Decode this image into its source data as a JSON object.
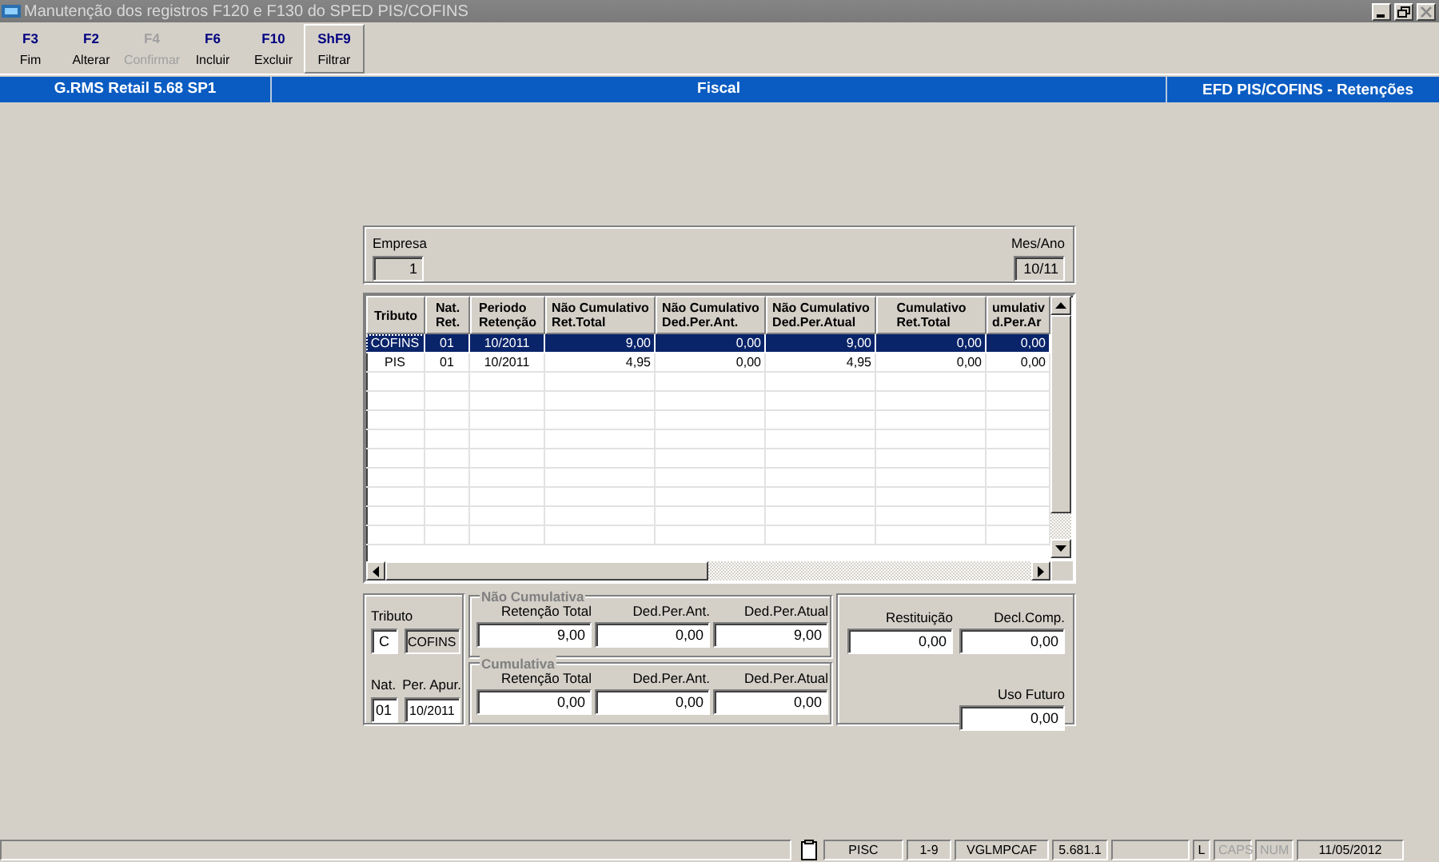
{
  "window": {
    "title": "Manutenção dos registros F120 e F130 do SPED PIS/COFINS"
  },
  "toolbar": [
    {
      "key": "F3",
      "label": "Fim",
      "disabled": false,
      "hover": false
    },
    {
      "key": "F2",
      "label": "Alterar",
      "disabled": false,
      "hover": false
    },
    {
      "key": "F4",
      "label": "Confirmar",
      "disabled": true,
      "hover": false
    },
    {
      "key": "F6",
      "label": "Incluir",
      "disabled": false,
      "hover": false
    },
    {
      "key": "F10",
      "label": "Excluir",
      "disabled": false,
      "hover": false
    },
    {
      "key": "ShF9",
      "label": "Filtrar",
      "disabled": false,
      "hover": true
    }
  ],
  "banner": {
    "left": "G.RMS Retail 5.68 SP1",
    "center": "Fiscal",
    "right": "EFD PIS/COFINS - Retenções"
  },
  "header": {
    "empresa": {
      "label": "Empresa",
      "value": "1"
    },
    "mes_ano": {
      "label": "Mes/Ano",
      "value": "10/11"
    }
  },
  "table": {
    "columns": [
      {
        "lines": [
          "Tributo"
        ]
      },
      {
        "lines": [
          "Nat.",
          "Ret."
        ]
      },
      {
        "lines": [
          "Periodo",
          "Retenção"
        ]
      },
      {
        "lines": [
          "Não Cumulativo",
          "Ret.Total"
        ]
      },
      {
        "lines": [
          "Não Cumulativo",
          "Ded.Per.Ant."
        ]
      },
      {
        "lines": [
          "Não Cumulativo",
          "Ded.Per.Atual"
        ]
      },
      {
        "lines": [
          "Cumulativo",
          "Ret.Total"
        ]
      },
      {
        "lines": [
          "umulativ",
          "d.Per.Ar"
        ]
      }
    ],
    "rows": [
      {
        "selected": true,
        "cells": [
          "COFINS",
          "01",
          "10/2011",
          "9,00",
          "0,00",
          "9,00",
          "0,00",
          "0,00"
        ]
      },
      {
        "selected": false,
        "cells": [
          "PIS",
          "01",
          "10/2011",
          "4,95",
          "0,00",
          "4,95",
          "0,00",
          "0,00"
        ]
      }
    ]
  },
  "detail": {
    "tributo": {
      "label": "Tributo",
      "code": "C",
      "name": "COFINS"
    },
    "nat": {
      "label": "Nat.",
      "value": "01"
    },
    "per_apur": {
      "label": "Per. Apur.",
      "value": "10/2011"
    },
    "groups": [
      {
        "title": "Não Cumulativa",
        "fields": [
          {
            "label": "Retenção Total",
            "value": "9,00"
          },
          {
            "label": "Ded.Per.Ant.",
            "value": "0,00"
          },
          {
            "label": "Ded.Per.Atual",
            "value": "9,00"
          }
        ]
      },
      {
        "title": "Cumulativa",
        "fields": [
          {
            "label": "Retenção Total",
            "value": "0,00"
          },
          {
            "label": "Ded.Per.Ant.",
            "value": "0,00"
          },
          {
            "label": "Ded.Per.Atual",
            "value": "0,00"
          }
        ]
      }
    ],
    "extra": [
      {
        "label": "Restituição",
        "value": "0,00"
      },
      {
        "label": "Decl.Comp.",
        "value": "0,00"
      },
      {
        "label": "Uso Futuro",
        "value": "0,00"
      }
    ]
  },
  "status_bar": [
    {
      "text": "PISC",
      "disabled": false
    },
    {
      "text": "1-9",
      "disabled": false
    },
    {
      "text": "VGLMPCAF",
      "disabled": false
    },
    {
      "text": "5.681.1",
      "disabled": false
    },
    {
      "text": "L",
      "disabled": false
    },
    {
      "text": "CAPS",
      "disabled": true
    },
    {
      "text": "NUM",
      "disabled": true
    },
    {
      "text": "11/05/2012",
      "disabled": false
    }
  ]
}
